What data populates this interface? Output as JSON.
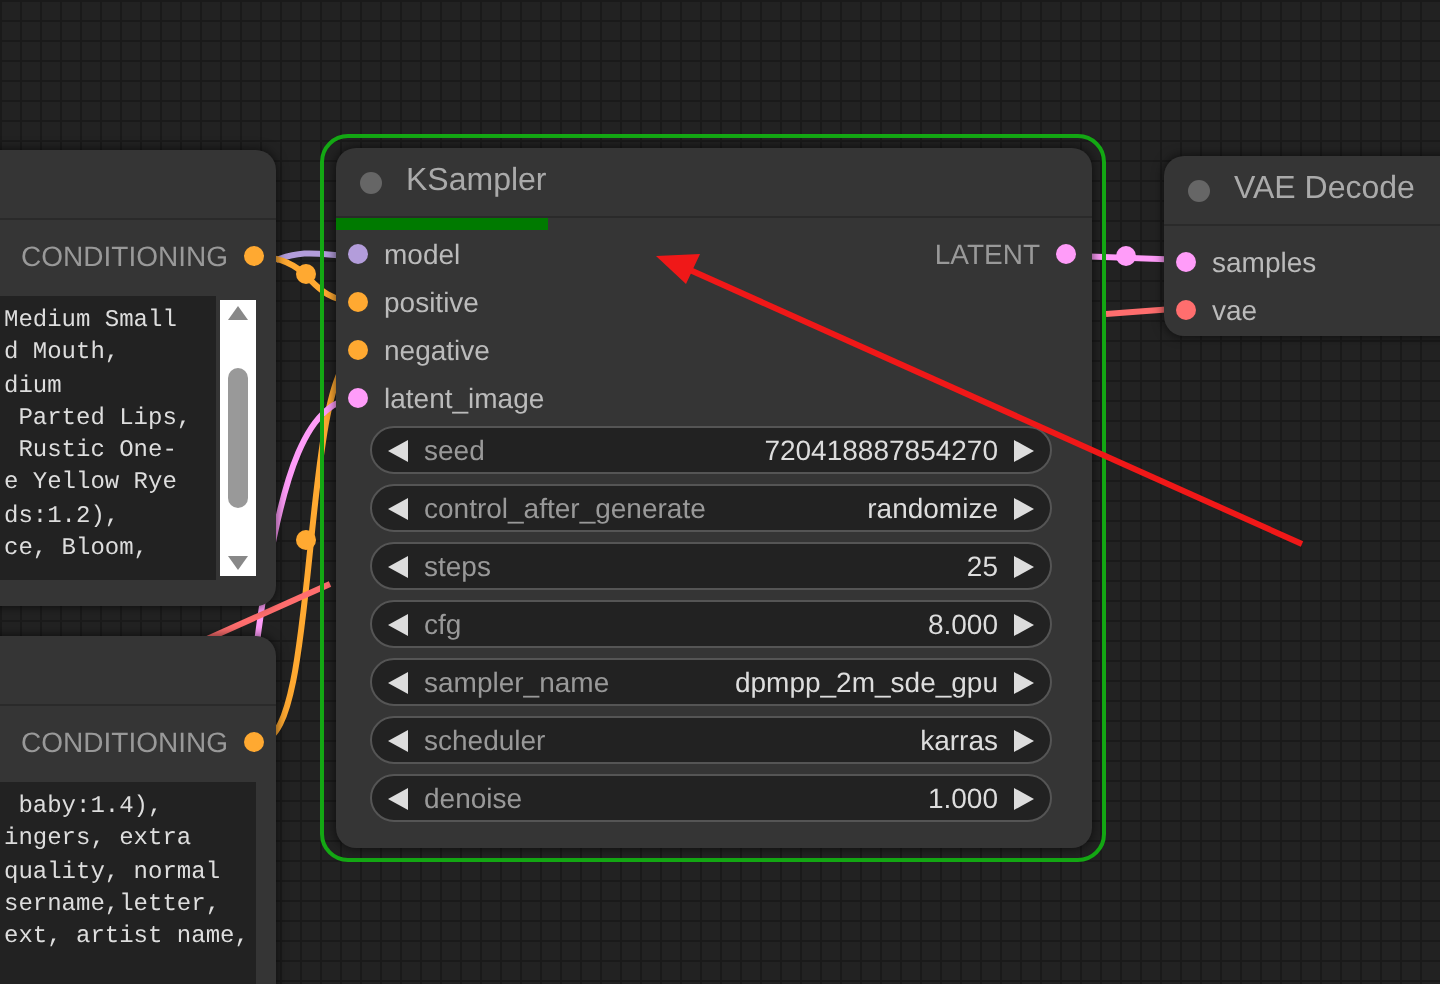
{
  "prompt_nodes": [
    {
      "output": {
        "label": "CONDITIONING",
        "color": "#ffa931"
      },
      "lines": [
        "Medium Small",
        "d Mouth,",
        "dium",
        " Parted Lips,",
        " Rustic One-",
        "e Yellow Rye",
        "ds:1.2),",
        "ce, Bloom,"
      ],
      "scrollbar": true
    },
    {
      "output": {
        "label": "CONDITIONING",
        "color": "#ffa931"
      },
      "lines": [
        " baby:1.4),",
        "ingers, extra",
        "quality, normal",
        "sername,letter,",
        "ext, artist name,"
      ],
      "scrollbar": false
    }
  ],
  "ksampler": {
    "title": "KSampler",
    "selected": true,
    "progress": {
      "level": 0.28
    },
    "inputs": [
      {
        "label": "model",
        "color": "#b39ddb"
      },
      {
        "label": "positive",
        "color": "#ffa931"
      },
      {
        "label": "negative",
        "color": "#ffa931"
      },
      {
        "label": "latent_image",
        "color": "#ff9cf9"
      }
    ],
    "outputs": [
      {
        "label": "LATENT",
        "color": "#ff9cf9"
      }
    ],
    "widgets": [
      {
        "name": "seed",
        "value": "720418887854270"
      },
      {
        "name": "control_after_generate",
        "value": "randomize"
      },
      {
        "name": "steps",
        "value": "25"
      },
      {
        "name": "cfg",
        "value": "8.000"
      },
      {
        "name": "sampler_name",
        "value": "dpmpp_2m_sde_gpu"
      },
      {
        "name": "scheduler",
        "value": "karras"
      },
      {
        "name": "denoise",
        "value": "1.000"
      }
    ]
  },
  "vae_decode": {
    "title": "VAE Decode",
    "inputs": [
      {
        "label": "samples",
        "color": "#ff9cf9"
      },
      {
        "label": "vae",
        "color": "#ff6e6e"
      }
    ]
  }
}
